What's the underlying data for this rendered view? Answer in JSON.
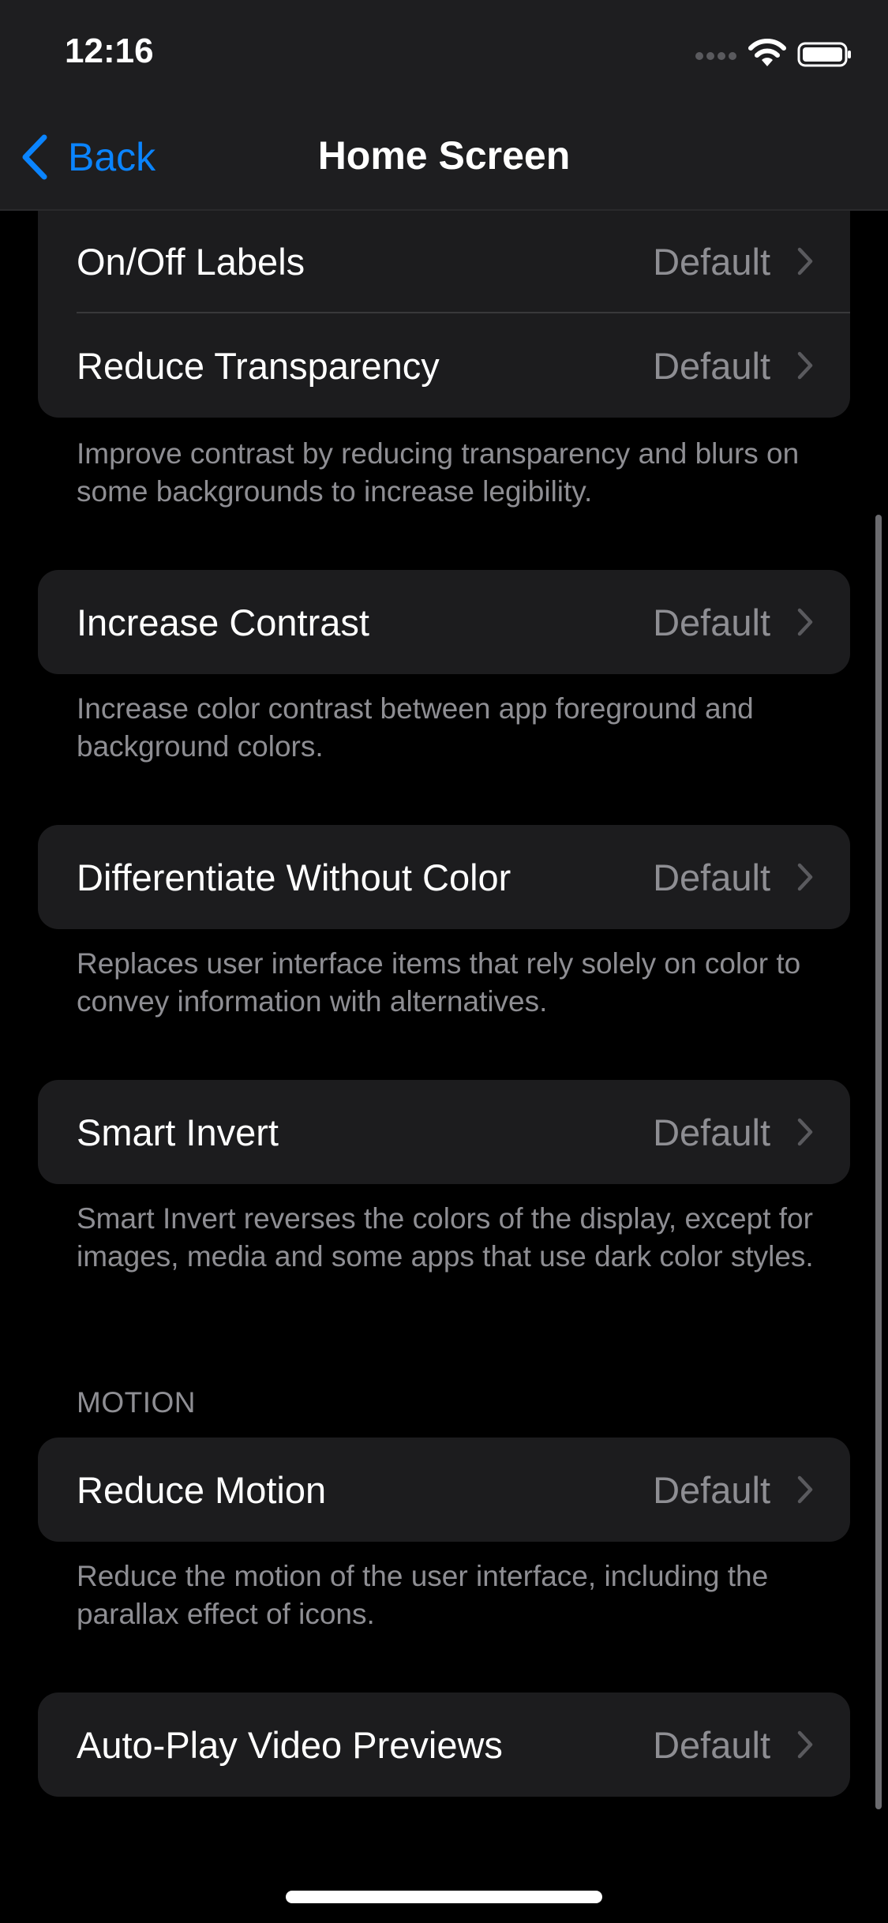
{
  "status_bar": {
    "time": "12:16",
    "icons": [
      "cellular-signal-icon",
      "wifi-icon",
      "battery-icon"
    ]
  },
  "nav": {
    "back_label": "Back",
    "title": "Home Screen",
    "back_icon": "chevron-left-icon"
  },
  "groups": {
    "display": {
      "rows": [
        {
          "label": "On/Off Labels",
          "value": "Default"
        },
        {
          "label": "Reduce Transparency",
          "value": "Default"
        }
      ],
      "footer": "Improve contrast by reducing transparency and blurs on some backgrounds to increase legibility."
    },
    "contrast": {
      "rows": [
        {
          "label": "Increase Contrast",
          "value": "Default"
        }
      ],
      "footer": "Increase color contrast between app foreground and background colors."
    },
    "differentiate": {
      "rows": [
        {
          "label": "Differentiate Without Color",
          "value": "Default"
        }
      ],
      "footer": "Replaces user interface items that rely solely on color to convey information with alternatives."
    },
    "invert": {
      "rows": [
        {
          "label": "Smart Invert",
          "value": "Default"
        }
      ],
      "footer": "Smart Invert reverses the colors of the display, except for images, media and some apps that use dark color styles."
    },
    "motion": {
      "header": "MOTION",
      "rows": [
        {
          "label": "Reduce Motion",
          "value": "Default"
        }
      ],
      "footer": "Reduce the motion of the user interface, including the parallax effect of icons."
    },
    "autoplay": {
      "rows": [
        {
          "label": "Auto-Play Video Previews",
          "value": "Default"
        }
      ]
    }
  },
  "colors": {
    "background": "#000000",
    "cell": "#1c1c1e",
    "accent": "#0a84ff",
    "secondary_text": "#8e8e93",
    "separator": "#38383a"
  }
}
